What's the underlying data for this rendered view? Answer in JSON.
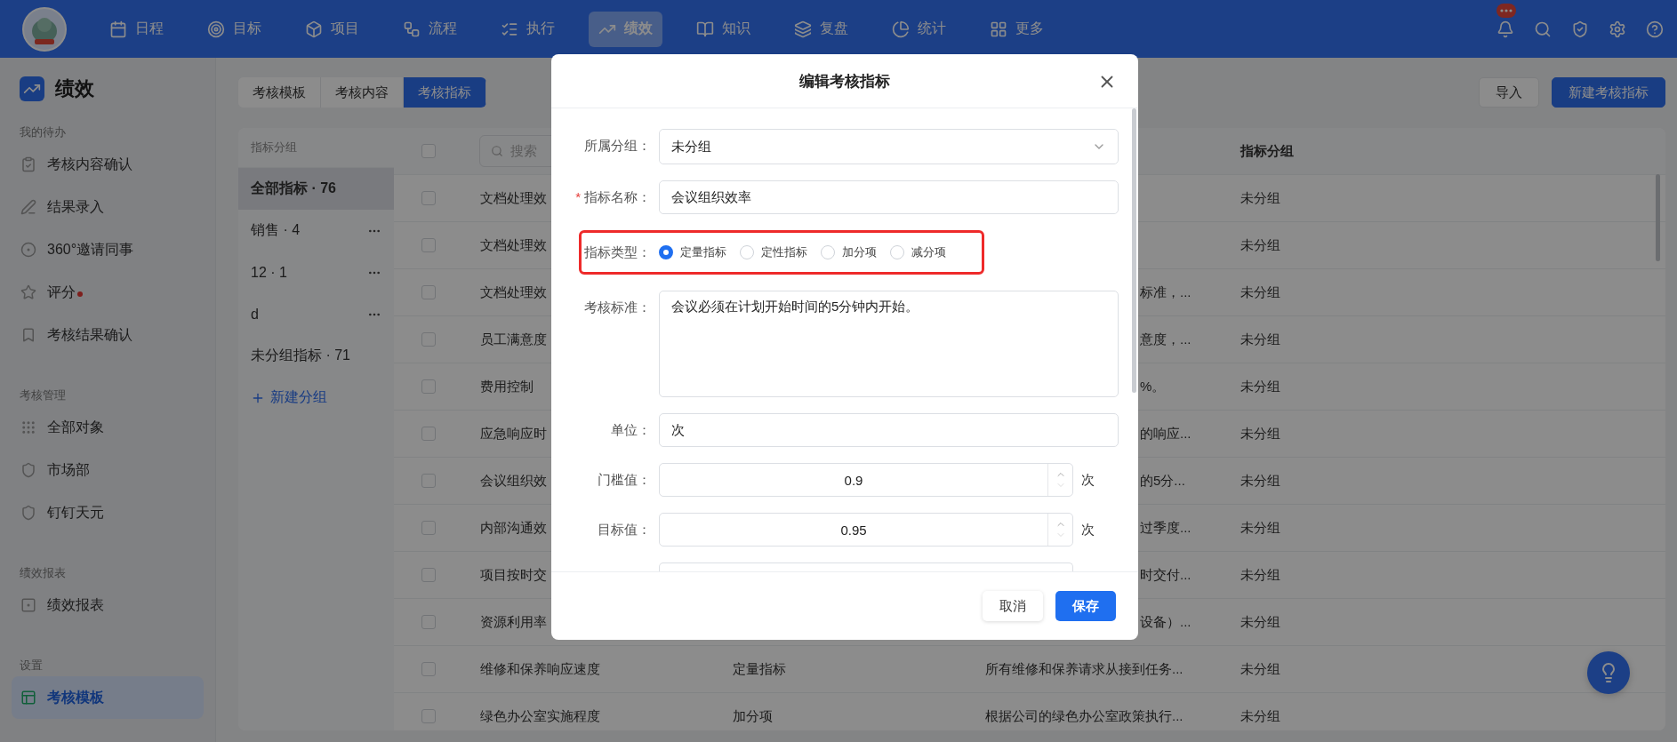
{
  "nav": {
    "items": [
      {
        "label": "日程",
        "selected": false
      },
      {
        "label": "目标",
        "selected": false
      },
      {
        "label": "项目",
        "selected": false
      },
      {
        "label": "流程",
        "selected": false
      },
      {
        "label": "执行",
        "selected": false
      },
      {
        "label": "绩效",
        "selected": true
      },
      {
        "label": "知识",
        "selected": false
      },
      {
        "label": "复盘",
        "selected": false
      },
      {
        "label": "统计",
        "selected": false
      },
      {
        "label": "更多",
        "selected": false
      }
    ]
  },
  "sidebar": {
    "title": "绩效",
    "sections": [
      {
        "heading": "我的待办",
        "items": [
          {
            "label": "考核内容确认",
            "selected": false,
            "unread": false
          },
          {
            "label": "结果录入",
            "selected": false,
            "unread": false
          },
          {
            "label": "360°邀请同事",
            "selected": false,
            "unread": false
          },
          {
            "label": "评分",
            "selected": false,
            "unread": true
          },
          {
            "label": "考核结果确认",
            "selected": false,
            "unread": false
          }
        ]
      },
      {
        "heading": "考核管理",
        "items": [
          {
            "label": "全部对象",
            "selected": false,
            "unread": false
          },
          {
            "label": "市场部",
            "selected": false,
            "unread": false
          },
          {
            "label": "钉钉天元",
            "selected": false,
            "unread": false
          }
        ]
      },
      {
        "heading": "绩效报表",
        "items": [
          {
            "label": "绩效报表",
            "selected": false,
            "unread": false
          }
        ]
      },
      {
        "heading": "设置",
        "items": [
          {
            "label": "考核模板",
            "selected": true,
            "unread": false
          }
        ]
      }
    ]
  },
  "tabs": [
    {
      "label": "考核模板",
      "selected": false
    },
    {
      "label": "考核内容",
      "selected": false
    },
    {
      "label": "考核指标",
      "selected": true
    }
  ],
  "actions": {
    "import": "导入",
    "create": "新建考核指标"
  },
  "groups": {
    "heading": "指标分组",
    "items": [
      {
        "label": "全部指标 · 76",
        "selected": true,
        "menu": false
      },
      {
        "label": "销售 · 4",
        "selected": false,
        "menu": true
      },
      {
        "label": "12 · 1",
        "selected": false,
        "menu": true
      },
      {
        "label": "d",
        "selected": false,
        "menu": true
      },
      {
        "label": "未分组指标 · 71",
        "selected": false,
        "menu": false
      }
    ],
    "add": "新建分组"
  },
  "table": {
    "search_placeholder": "搜索",
    "group_heading": "指标分组",
    "header_checked": false,
    "rows": [
      {
        "checked": false,
        "name": "文档处理效",
        "group": "未分组"
      },
      {
        "checked": false,
        "name": "文档处理效",
        "group": "未分组"
      },
      {
        "checked": false,
        "name": "文档处理效",
        "standard": "标准，...",
        "group": "未分组"
      },
      {
        "checked": false,
        "name": "员工满意度",
        "standard": "意度，...",
        "group": "未分组"
      },
      {
        "checked": false,
        "name": "费用控制",
        "standard": "%。",
        "group": "未分组"
      },
      {
        "checked": false,
        "name": "应急响应时",
        "standard": "的响应...",
        "group": "未分组"
      },
      {
        "checked": false,
        "name": "会议组织效",
        "standard": "的5分...",
        "group": "未分组"
      },
      {
        "checked": false,
        "name": "内部沟通效",
        "standard": "过季度...",
        "group": "未分组"
      },
      {
        "checked": false,
        "name": "项目按时交",
        "standard": "时交付...",
        "group": "未分组"
      },
      {
        "checked": false,
        "name": "资源利用率",
        "standard": "设备）...",
        "group": "未分组"
      },
      {
        "checked": false,
        "name": "维修和保养响应速度",
        "type": "定量指标",
        "standard": "所有维修和保养请求从接到任务...",
        "group": "未分组"
      },
      {
        "checked": false,
        "name": "绿色办公室实施程度",
        "type": "加分项",
        "standard": "根据公司的绿色办公室政策执行...",
        "group": "未分组"
      }
    ]
  },
  "dialog": {
    "title": "编辑考核指标",
    "fields": [
      {
        "kind": "select",
        "label": "所属分组：",
        "value": "未分组"
      },
      {
        "kind": "text",
        "label": "指标名称：",
        "required_mark": "*",
        "value": "会议组织效率"
      },
      {
        "kind": "radio",
        "label": "指标类型：",
        "highlighted": true,
        "options": [
          {
            "label": "定量指标",
            "selected": true
          },
          {
            "label": "定性指标",
            "selected": false
          },
          {
            "label": "加分项",
            "selected": false
          },
          {
            "label": "减分项",
            "selected": false
          }
        ]
      },
      {
        "kind": "textarea",
        "label": "考核标准：",
        "value": "会议必须在计划开始时间的5分钟内开始。"
      },
      {
        "kind": "text",
        "label": "单位：",
        "value": "次"
      },
      {
        "kind": "number",
        "label": "门槛值：",
        "value": "0.9",
        "suffix": "次"
      },
      {
        "kind": "number",
        "label": "目标值：",
        "value": "0.95",
        "suffix": "次"
      },
      {
        "kind": "clipped"
      }
    ],
    "cancel": "取消",
    "save": "保存"
  }
}
